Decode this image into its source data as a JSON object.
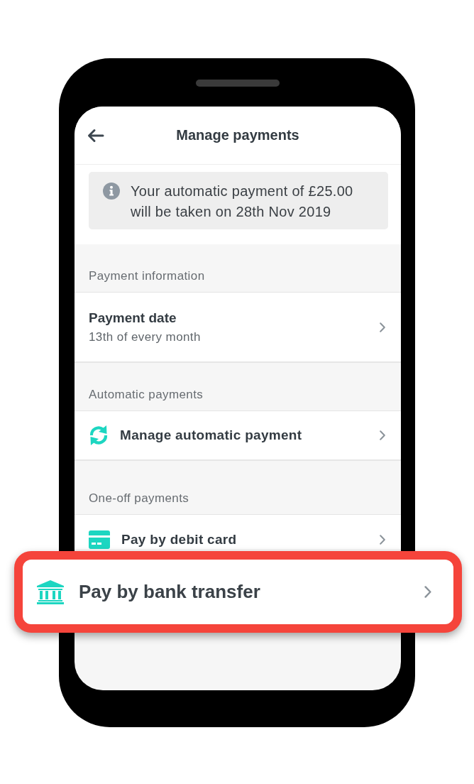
{
  "header": {
    "title": "Manage payments"
  },
  "notice": {
    "text": "Your automatic payment of £25.00 will be taken on 28th Nov 2019"
  },
  "sections": [
    {
      "heading": "Payment information",
      "items": [
        {
          "kind": "detail",
          "title": "Payment date",
          "subtitle": "13th of every month"
        }
      ]
    },
    {
      "heading": "Automatic payments",
      "items": [
        {
          "kind": "recurring",
          "title": "Manage automatic payment"
        }
      ]
    },
    {
      "heading": "One-off payments",
      "items": [
        {
          "kind": "card",
          "title": "Pay by debit card"
        }
      ]
    }
  ],
  "callout": {
    "kind": "bank",
    "title": "Pay by bank transfer"
  }
}
